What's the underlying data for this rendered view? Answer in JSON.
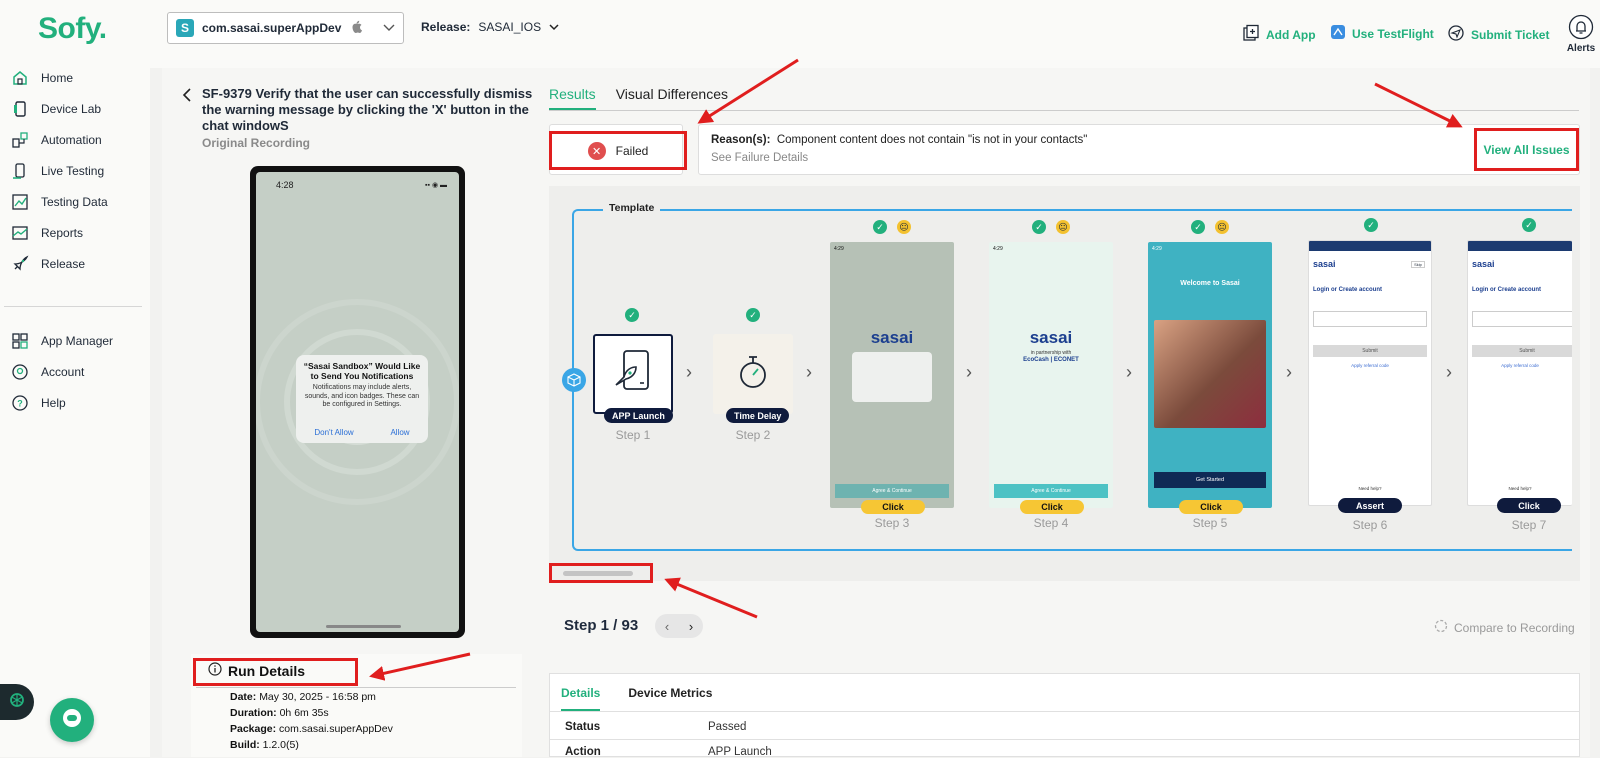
{
  "brand": {
    "logo": "Sofy.",
    "accent": "#22b07d"
  },
  "sidebar": {
    "items": [
      {
        "label": "Home",
        "icon": "home-icon"
      },
      {
        "label": "Device Lab",
        "icon": "device-icon"
      },
      {
        "label": "Automation",
        "icon": "automation-icon"
      },
      {
        "label": "Live Testing",
        "icon": "live-testing-icon"
      },
      {
        "label": "Testing Data",
        "icon": "testing-data-icon"
      },
      {
        "label": "Reports",
        "icon": "reports-icon"
      },
      {
        "label": "Release",
        "icon": "rocket-icon"
      },
      {
        "label": "App Manager",
        "icon": "app-manager-icon"
      },
      {
        "label": "Account",
        "icon": "account-icon"
      },
      {
        "label": "Help",
        "icon": "help-icon"
      }
    ]
  },
  "topbar": {
    "app_package": "com.sasai.superAppDev",
    "release_label": "Release:",
    "release_value": "SASAI_IOS",
    "add_app": "Add App",
    "use_testflight": "Use TestFlight",
    "submit_ticket": "Submit Ticket",
    "alerts": "Alerts"
  },
  "test": {
    "title": "SF-9379 Verify that the user can successfully dismiss the warning message by clicking the 'X' button in the chat windowS",
    "subtitle": "Original Recording"
  },
  "phone": {
    "time": "4:28",
    "notif_title": "“Sasai Sandbox” Would Like to Send You Notifications",
    "notif_body": "Notifications may include alerts, sounds, and icon badges. These can be configured in Settings.",
    "dont_allow": "Don't Allow",
    "allow": "Allow"
  },
  "run_details": {
    "title": "Run Details",
    "date_label": "Date:",
    "date": "May 30, 2025 - 16:58 pm",
    "duration_label": "Duration:",
    "duration": "0h 6m 35s",
    "package_label": "Package:",
    "package": "com.sasai.superAppDev",
    "build_label": "Build:",
    "build": "1.2.0(5)"
  },
  "tabs": {
    "results": "Results",
    "visual_diff": "Visual Differences"
  },
  "status": {
    "result": "Failed",
    "reason_label": "Reason(s):",
    "reason": "Component content does not contain \"is not in your contacts\"",
    "see_failure": "See Failure Details",
    "view_all": "View All Issues"
  },
  "template": {
    "label": "Template",
    "steps": [
      {
        "label": "Step 1",
        "action": "APP Launch"
      },
      {
        "label": "Step 2",
        "action": "Time Delay"
      },
      {
        "label": "Step 3",
        "action": "Click"
      },
      {
        "label": "Step 4",
        "action": "Click"
      },
      {
        "label": "Step 5",
        "action": "Click"
      },
      {
        "label": "Step 6",
        "action": "Assert"
      },
      {
        "label": "Step 7",
        "action": "Click"
      }
    ],
    "shots": {
      "time": "4:29",
      "brand": "sasai",
      "welcome": "Welcome to Sasai",
      "get_started": "Get Started",
      "login": "Login or Create account",
      "submit": "Submit",
      "partnership": "in partnership with",
      "partners": "EcoCash | ECONET",
      "agree": "Agree & Continue",
      "referral": "Apply referral code",
      "need_help": "Need help?",
      "skip": "Skip"
    }
  },
  "navigator": {
    "step_count": "Step 1 / 93",
    "compare": "Compare to Recording"
  },
  "details": {
    "tab_details": "Details",
    "tab_metrics": "Device Metrics",
    "status_label": "Status",
    "status_value": "Passed",
    "action_label": "Action",
    "action_value": "APP Launch"
  }
}
